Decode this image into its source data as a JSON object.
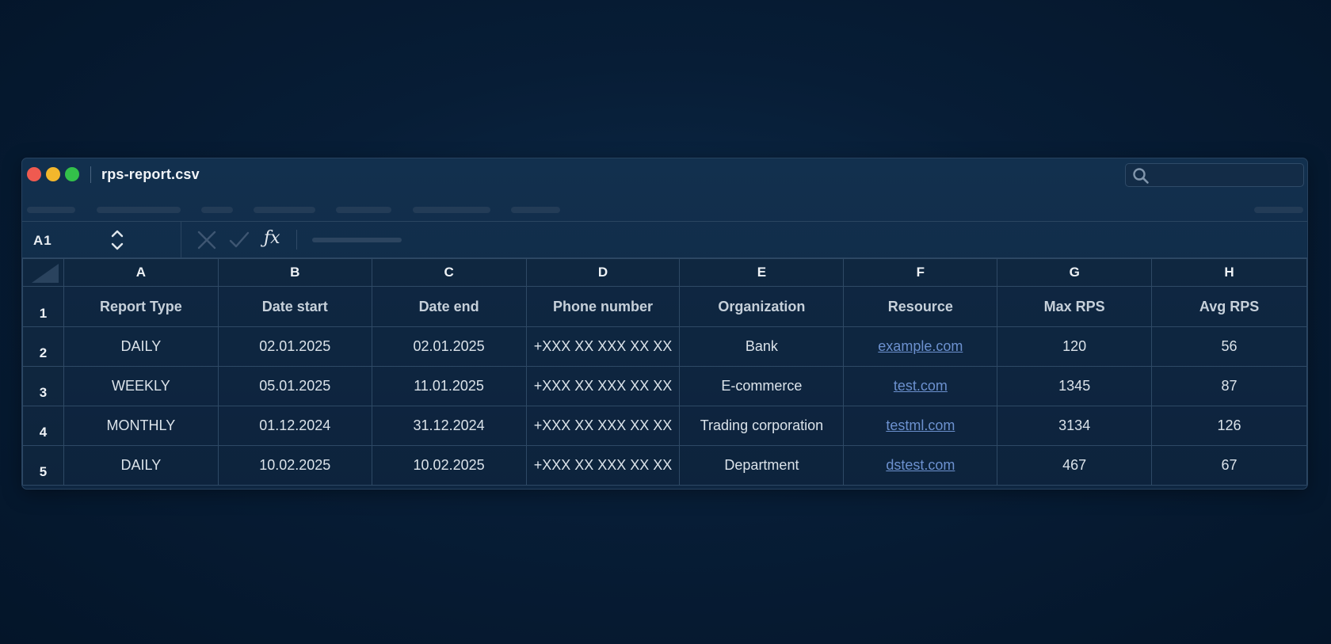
{
  "window": {
    "title": "rps-report.csv"
  },
  "formula_bar": {
    "cell_ref": "A1",
    "fx_label": "ƒx"
  },
  "columns": [
    "A",
    "B",
    "C",
    "D",
    "E",
    "F",
    "G",
    "H"
  ],
  "row_numbers": [
    "1",
    "2",
    "3",
    "4",
    "5"
  ],
  "header_row": [
    "Report Type",
    "Date start",
    "Date end",
    "Phone number",
    "Organization",
    "Resource",
    "Max RPS",
    "Avg RPS"
  ],
  "rows": [
    {
      "report_type": "DAILY",
      "date_start": "02.01.2025",
      "date_end": "02.01.2025",
      "phone": "+XXX XX XXX XX XX",
      "organization": "Bank",
      "resource": "example.com",
      "max_rps": "120",
      "avg_rps": "56"
    },
    {
      "report_type": "WEEKLY",
      "date_start": "05.01.2025",
      "date_end": "11.01.2025",
      "phone": "+XXX XX XXX XX XX",
      "organization": "E-commerce",
      "resource": "test.com",
      "max_rps": "1345",
      "avg_rps": "87"
    },
    {
      "report_type": "MONTHLY",
      "date_start": "01.12.2024",
      "date_end": "31.12.2024",
      "phone": "+XXX XX XXX XX XX",
      "organization": "Trading corporation",
      "resource": "testml.com",
      "max_rps": "3134",
      "avg_rps": "126"
    },
    {
      "report_type": "DAILY",
      "date_start": "10.02.2025",
      "date_end": "10.02.2025",
      "phone": "+XXX XX XXX XX XX",
      "organization": "Department",
      "resource": "dstest.com",
      "max_rps": "467",
      "avg_rps": "67"
    }
  ],
  "colors": {
    "background": "#041529",
    "window": "#12304e",
    "link": "#6c91cf",
    "close": "#ef5a50",
    "minimize": "#f3b72c",
    "maximize": "#33c14a"
  }
}
